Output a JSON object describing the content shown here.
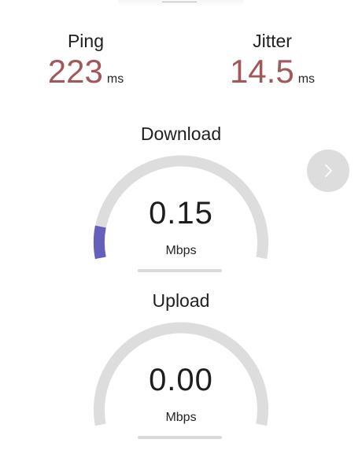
{
  "ping": {
    "label": "Ping",
    "value": "223",
    "unit": "ms"
  },
  "jitter": {
    "label": "Jitter",
    "value": "14.5",
    "unit": "ms"
  },
  "download": {
    "title": "Download",
    "value": "0.15",
    "unit": "Mbps",
    "gauge_level": 0.04
  },
  "upload": {
    "title": "Upload",
    "value": "0.00",
    "unit": "Mbps",
    "gauge_level": 0
  },
  "colors": {
    "metric_value": "#a1585a",
    "gauge_track": "#dddddd",
    "gauge_fill": "#665fbb",
    "button_bg": "#dddddd"
  },
  "icons": {
    "next": "chevron-right-icon"
  }
}
